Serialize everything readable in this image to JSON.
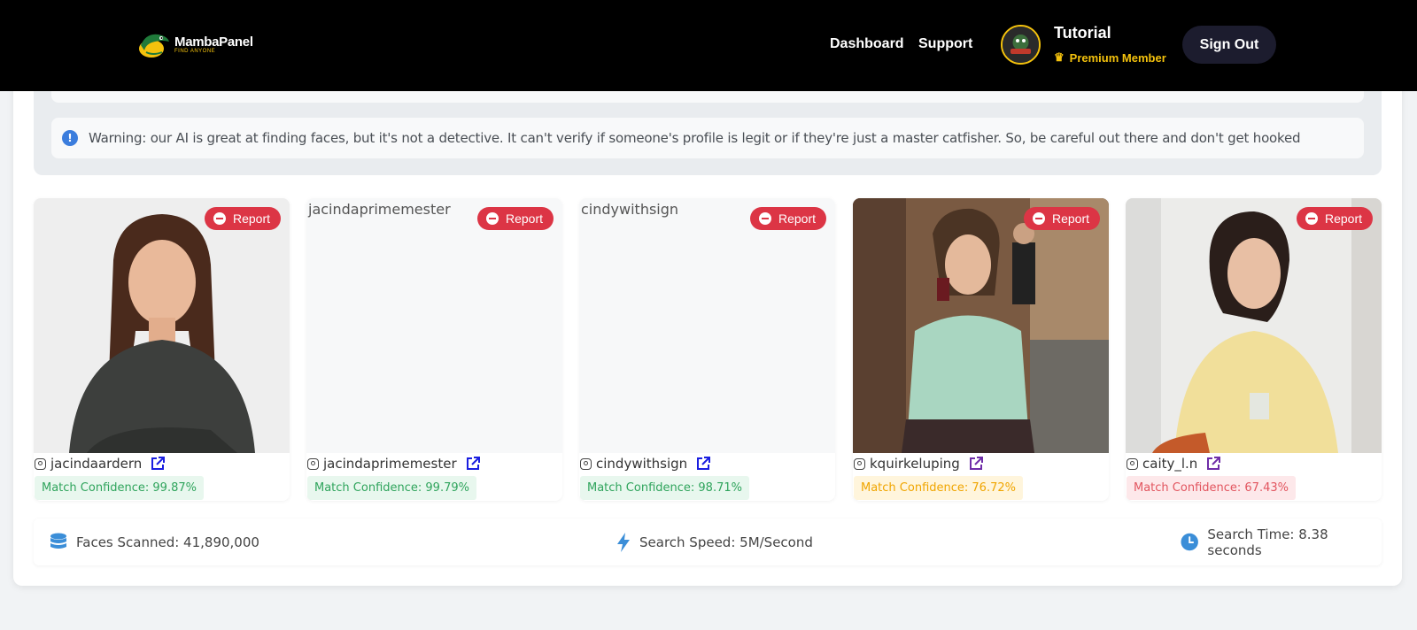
{
  "header": {
    "logo": {
      "name": "MambaPanel",
      "tagline": "FIND ANYONE"
    },
    "nav": [
      "Dashboard",
      "Support"
    ],
    "user": {
      "name": "Tutorial",
      "badge": "Premium Member"
    },
    "signout_label": "Sign Out"
  },
  "warning": {
    "text": "Warning: our AI is great at finding faces, but it's not a detective. It can't verify if someone's profile is legit or if they're just a master catfisher. So, be careful out there and don't get hooked"
  },
  "results": [
    {
      "username": "jacindaardern",
      "report_label": "Report",
      "confidence": "Match Confidence: 99.87%",
      "level": "green",
      "image_alt": ""
    },
    {
      "username": "jacindaprimemester",
      "report_label": "Report",
      "confidence": "Match Confidence: 99.79%",
      "level": "green",
      "image_alt": "jacindaprimemester"
    },
    {
      "username": "cindywithsign",
      "report_label": "Report",
      "confidence": "Match Confidence: 98.71%",
      "level": "green",
      "image_alt": "cindywithsign"
    },
    {
      "username": "kquirkeluping",
      "report_label": "Report",
      "confidence": "Match Confidence: 76.72%",
      "level": "yellow",
      "image_alt": ""
    },
    {
      "username": "caity_l.n",
      "report_label": "Report",
      "confidence": "Match Confidence: 67.43%",
      "level": "red",
      "image_alt": ""
    }
  ],
  "stats": {
    "faces_scanned": "Faces Scanned: 41,890,000",
    "search_speed": "Search Speed: 5M/Second",
    "search_time": "Search Time: 8.38 seconds"
  },
  "colors": {
    "header_bg": "#000000",
    "accent_gold": "#f4c20d",
    "report_red": "#dc3545",
    "link_blue": "#1a1ee0",
    "link_purple": "#6f2da8"
  }
}
